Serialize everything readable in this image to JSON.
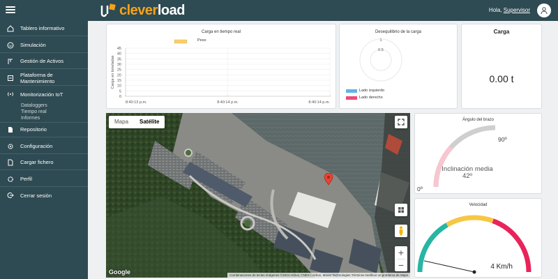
{
  "header": {
    "logo_part1": "clever",
    "logo_part2": "load",
    "greeting": "Hola,",
    "user": "Supervisor"
  },
  "sidebar": {
    "items": [
      {
        "label": "Tablero informativo",
        "icon": "dashboard-icon"
      },
      {
        "label": "Simulación",
        "icon": "simulation-icon"
      },
      {
        "label": "Gestión de Activos",
        "icon": "crane-icon"
      },
      {
        "label": "Plataforma de Mantenimiento",
        "icon": "maintenance-icon"
      },
      {
        "label": "Monitorización IoT",
        "icon": "iot-icon"
      },
      {
        "label": "Repositorio",
        "icon": "document-icon"
      },
      {
        "label": "Configuración",
        "icon": "gear-icon"
      },
      {
        "label": "Cargar fichero",
        "icon": "file-icon"
      },
      {
        "label": "Perfil",
        "icon": "settings-icon"
      },
      {
        "label": "Cerrar sesión",
        "icon": "logout-icon"
      }
    ],
    "sub_items": [
      "Dataloggers",
      "Tiempo real",
      "Informes"
    ]
  },
  "load_chart": {
    "title": "Carga en tiempo real",
    "legend": "Peso",
    "ylabel": "Carga en toneladas",
    "chart_data": {
      "type": "bar",
      "title": "Carga en tiempo real",
      "ylabel": "Carga en toneladas",
      "categories": [
        "8:40:13 p.m.",
        "8:40:14 p.m.",
        "8:40:14 p.m."
      ],
      "series": [
        {
          "name": "Peso",
          "values": [
            0,
            0,
            0
          ]
        }
      ],
      "ylim": [
        0,
        45
      ],
      "yticks": [
        "0",
        "5",
        "10",
        "15",
        "20",
        "25",
        "30",
        "35",
        "40",
        "45"
      ],
      "grid": true,
      "color": "#f7cf6a"
    }
  },
  "imbalance_chart": {
    "title": "Desequilibrio de la carga",
    "tick_1": "1",
    "tick_05": "0.5",
    "legend_left": "Lado izquierdo",
    "legend_right": "Lado derecho",
    "color_left": "#5fb4e8",
    "color_right": "#ee4b7a"
  },
  "load_card": {
    "title": "Carga",
    "value": "0.00 t"
  },
  "arm_angle": {
    "title": "Ángulo del brazo",
    "max_label": "90º",
    "min_label": "0º",
    "caption": "Inclinación media",
    "value_text": "42º",
    "value": 42,
    "min": 0,
    "max": 90
  },
  "speed": {
    "title": "Velocidad",
    "value_text": "4 Km/h",
    "value_fraction": 0.07,
    "colors": [
      "#27b5a4",
      "#f6c744",
      "#e8245a"
    ]
  },
  "map": {
    "type_map": "Mapa",
    "type_satellite": "Satélite",
    "google": "Google",
    "attribution": "Combinaciones de teclas   Imágenes ©2024 Airbus, CNES / Airbus, Maxar Technologies   Términos   Notificar un problema de Maps"
  }
}
